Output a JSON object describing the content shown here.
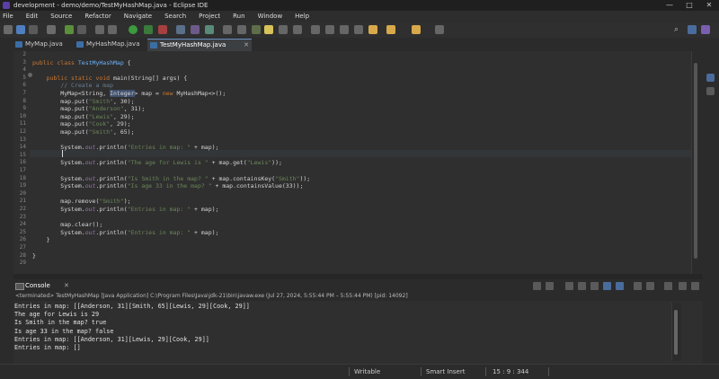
{
  "window": {
    "title": "development - demo/demo/TestMyHashMap.java - Eclipse IDE",
    "controls": [
      "—",
      "□",
      "✕"
    ]
  },
  "menu": [
    "File",
    "Edit",
    "Source",
    "Refactor",
    "Navigate",
    "Search",
    "Project",
    "Run",
    "Window",
    "Help"
  ],
  "tabs": [
    {
      "label": "MyMap.java",
      "active": false
    },
    {
      "label": "MyHashMap.java",
      "active": false
    },
    {
      "label": "TestMyHashMap.java",
      "active": true
    }
  ],
  "editor": {
    "lines": [
      {
        "n": "2",
        "html": ""
      },
      {
        "n": "3",
        "html": "<span class=\"kw\">public class</span> <span class=\"cls\">TestMyHashMap</span> {"
      },
      {
        "n": "4",
        "html": ""
      },
      {
        "n": "5",
        "html": "    <span class=\"kw\">public static void</span> main(String[] args) {"
      },
      {
        "n": "6",
        "html": "        <span class=\"cm\">// Create a map</span>"
      },
      {
        "n": "7",
        "html": "        MyMap&lt;String, <span class=\"hl\">Integer</span>&gt; map = <span class=\"kw\">new</span> MyHashMap&lt;&gt;();"
      },
      {
        "n": "8",
        "html": "        map.put(<span class=\"st\">\"Smith\"</span>, 30);"
      },
      {
        "n": "9",
        "html": "        map.put(<span class=\"st\">\"Anderson\"</span>, 31);"
      },
      {
        "n": "10",
        "html": "        map.put(<span class=\"st\">\"Lewis\"</span>, 29);"
      },
      {
        "n": "11",
        "html": "        map.put(<span class=\"st\">\"Cook\"</span>, 29);"
      },
      {
        "n": "12",
        "html": "        map.put(<span class=\"st\">\"Smith\"</span>, 65);"
      },
      {
        "n": "13",
        "html": ""
      },
      {
        "n": "14",
        "html": "        System.<span class=\"fd\">out</span>.println(<span class=\"st\">\"Entries in map: \"</span> + map);"
      },
      {
        "n": "15",
        "html": ""
      },
      {
        "n": "16",
        "html": "        System.<span class=\"fd\">out</span>.println(<span class=\"st\">\"The age for Lewis is \"</span> + map.get(<span class=\"st\">\"Lewis\"</span>));"
      },
      {
        "n": "17",
        "html": ""
      },
      {
        "n": "18",
        "html": "        System.<span class=\"fd\">out</span>.println(<span class=\"st\">\"Is Smith in the map? \"</span> + map.containsKey(<span class=\"st\">\"Smith\"</span>));"
      },
      {
        "n": "19",
        "html": "        System.<span class=\"fd\">out</span>.println(<span class=\"st\">\"Is age 33 in the map? \"</span> + map.containsValue(33));"
      },
      {
        "n": "20",
        "html": ""
      },
      {
        "n": "21",
        "html": "        map.remove(<span class=\"st\">\"Smith\"</span>);"
      },
      {
        "n": "22",
        "html": "        System.<span class=\"fd\">out</span>.println(<span class=\"st\">\"Entries in map: \"</span> + map);"
      },
      {
        "n": "23",
        "html": ""
      },
      {
        "n": "24",
        "html": "        map.clear();"
      },
      {
        "n": "25",
        "html": "        System.<span class=\"fd\">out</span>.println(<span class=\"st\">\"Entries in map: \"</span> + map);"
      },
      {
        "n": "26",
        "html": "    }"
      },
      {
        "n": "27",
        "html": ""
      },
      {
        "n": "28",
        "html": "}"
      },
      {
        "n": "29",
        "html": ""
      }
    ]
  },
  "console": {
    "tab_label": "Console",
    "info": "<terminated> TestMyHashMap [Java Application] C:\\Program Files\\Java\\jdk-21\\bin\\javaw.exe  (Jul 27, 2024, 5:55:44 PM – 5:55:44 PM) [pid: 14092]",
    "output": [
      "Entries in map: [[Anderson, 31][Smith, 65][Lewis, 29][Cook, 29]]",
      "The age for Lewis is 29",
      "Is Smith in the map? true",
      "Is age 33 in the map? false",
      "Entries in map: [[Anderson, 31][Lewis, 29][Cook, 29]]",
      "Entries in map: []"
    ]
  },
  "status": {
    "writable": "Writable",
    "insert_mode": "Smart Insert",
    "position": "15 : 9 : 344"
  }
}
